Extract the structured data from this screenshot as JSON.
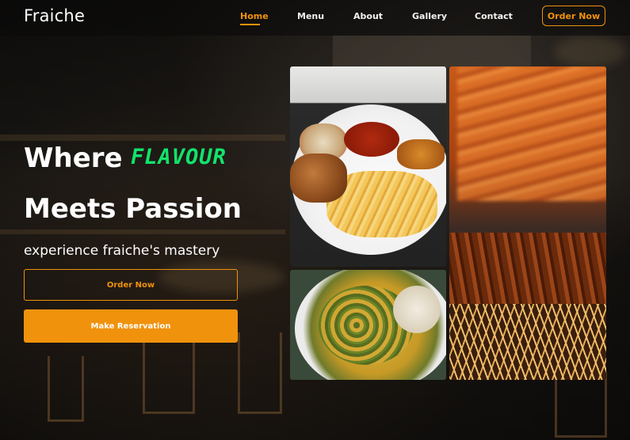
{
  "brand": {
    "name": "Fraiche",
    "accent_color": "#f0920c",
    "highlight_color": "#12e36b"
  },
  "nav": {
    "items": [
      {
        "label": "Home",
        "active": true
      },
      {
        "label": "Menu",
        "active": false
      },
      {
        "label": "About",
        "active": false
      },
      {
        "label": "Gallery",
        "active": false
      },
      {
        "label": "Contact",
        "active": false
      }
    ],
    "cta_label": "Order Now"
  },
  "hero": {
    "title_part1": "Where",
    "title_accent": "FLAVOUR",
    "title_line2": "Meets Passion",
    "subtitle": "experience fraiche's mastery",
    "primary_button": "Order Now",
    "secondary_button": "Make Reservation"
  },
  "gallery": {
    "photos": [
      {
        "name": "plate-fries-chicken-photo"
      },
      {
        "name": "egusi-soup-photo"
      },
      {
        "name": "suya-skewers-photo"
      }
    ]
  }
}
